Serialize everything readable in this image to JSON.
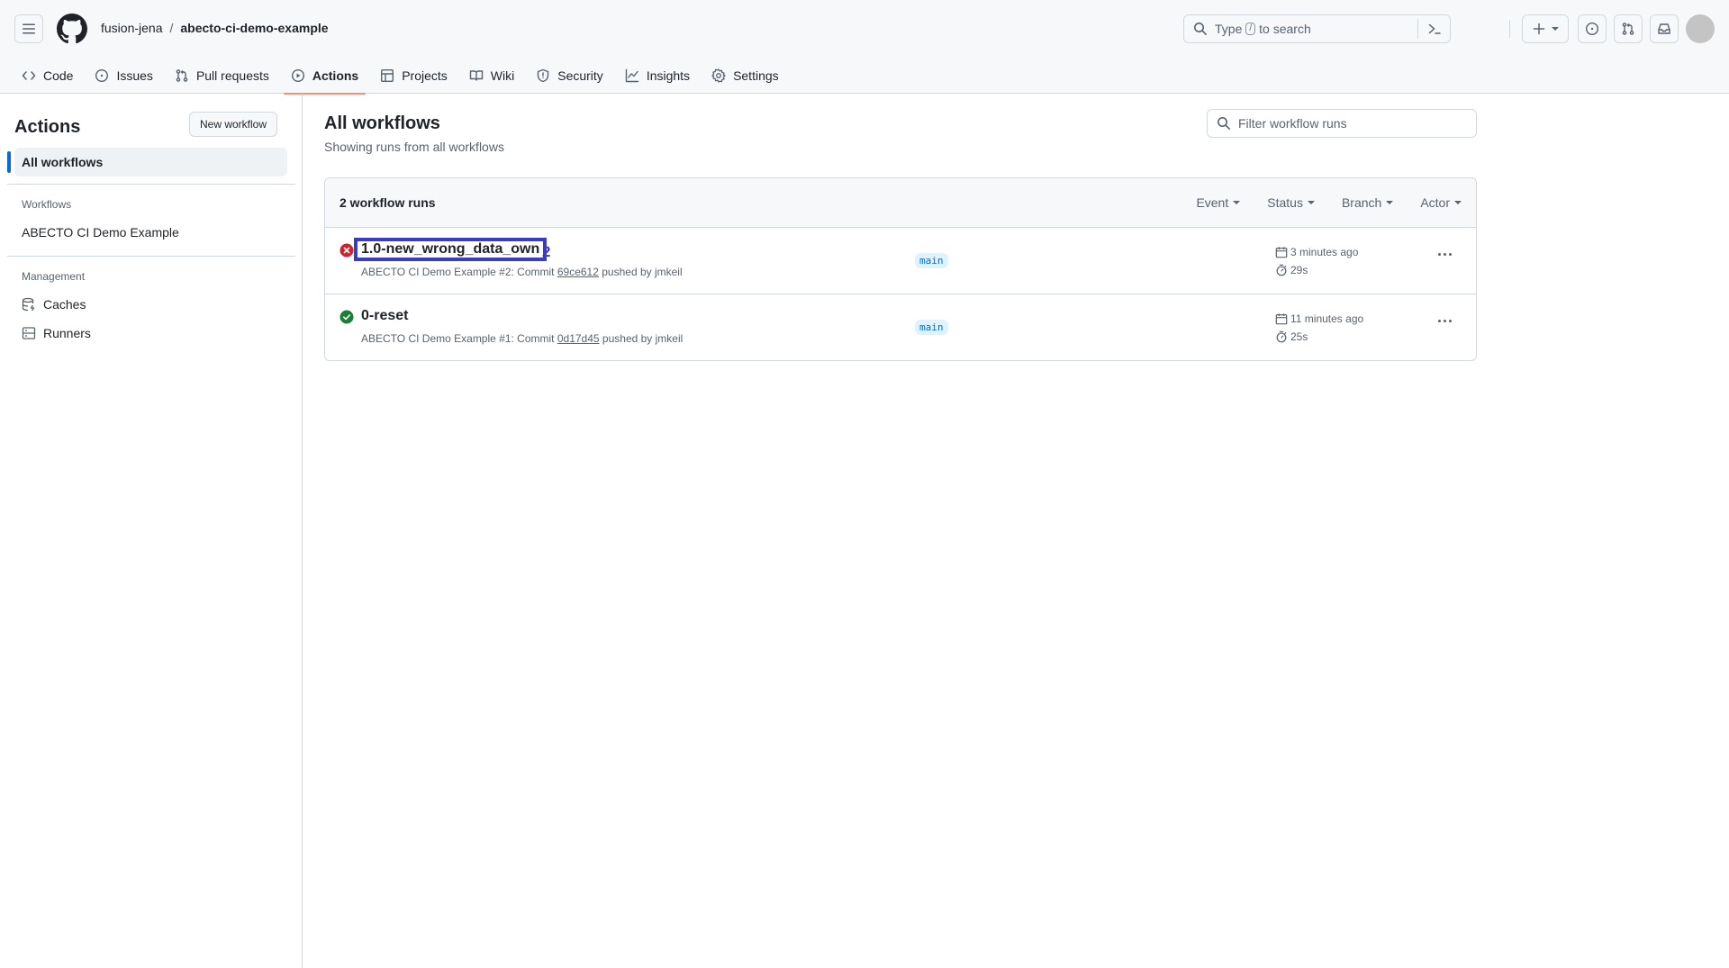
{
  "header": {
    "owner": "fusion-jena",
    "separator": "/",
    "repo": "abecto-ci-demo-example",
    "search_prefix": "Type",
    "search_key": "/",
    "search_suffix": "to search"
  },
  "repo_nav": {
    "tabs": [
      {
        "label": "Code",
        "icon": "code-icon"
      },
      {
        "label": "Issues",
        "icon": "issue-icon"
      },
      {
        "label": "Pull requests",
        "icon": "pull-request-icon"
      },
      {
        "label": "Actions",
        "icon": "play-icon",
        "selected": true
      },
      {
        "label": "Projects",
        "icon": "table-icon"
      },
      {
        "label": "Wiki",
        "icon": "book-icon"
      },
      {
        "label": "Security",
        "icon": "shield-icon"
      },
      {
        "label": "Insights",
        "icon": "graph-icon"
      },
      {
        "label": "Settings",
        "icon": "gear-icon"
      }
    ]
  },
  "sidebar": {
    "title": "Actions",
    "new_workflow": "New workflow",
    "all_workflows": "All workflows",
    "workflows_heading": "Workflows",
    "workflows": [
      "ABECTO CI Demo Example"
    ],
    "management_heading": "Management",
    "management": [
      {
        "label": "Caches",
        "icon": "database-icon"
      },
      {
        "label": "Runners",
        "icon": "server-icon"
      }
    ]
  },
  "main": {
    "title": "All workflows",
    "subtitle": "Showing runs from all workflows",
    "filter_placeholder": "Filter workflow runs",
    "runs_count": "2 workflow runs",
    "filters": [
      "Event",
      "Status",
      "Branch",
      "Actor"
    ],
    "runs": [
      {
        "title": "1.0-new_wrong_data_own",
        "status": "failure",
        "workflow": "ABECTO CI Demo Example #2: Commit",
        "sha": "69ce612",
        "pushed_by": "pushed by jmkeil",
        "branch": "main",
        "time": "3 minutes ago",
        "duration": "29s",
        "highlight_label": "2"
      },
      {
        "title": "0-reset",
        "status": "success",
        "workflow": "ABECTO CI Demo Example #1: Commit",
        "sha": "0d17d45",
        "pushed_by": "pushed by jmkeil",
        "branch": "main",
        "time": "11 minutes ago",
        "duration": "25s"
      }
    ]
  },
  "colors": {
    "accent": "#0969da",
    "failure": "#cf222e",
    "success": "#1a7f37",
    "tab_underline": "#fd8c73",
    "highlight": "#3b3dbf"
  }
}
